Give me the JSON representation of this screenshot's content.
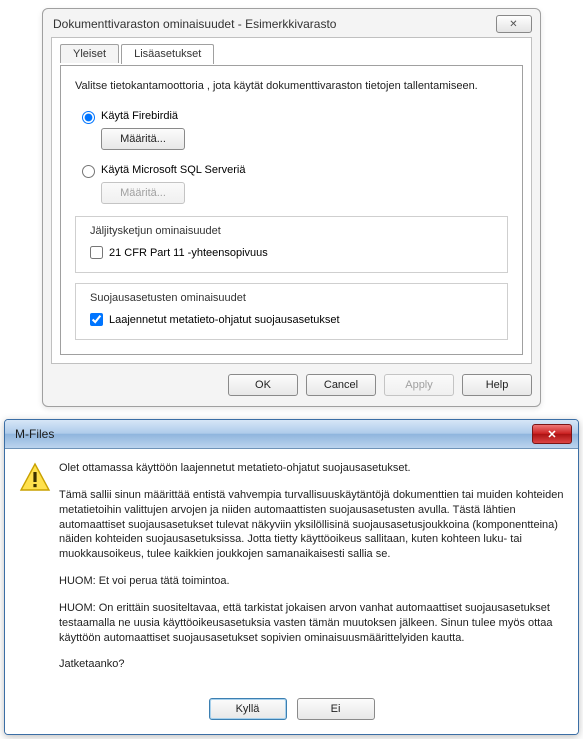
{
  "dialog": {
    "title": "Dokumenttivaraston ominaisuudet - Esimerkkivarasto",
    "close_glyph": "✕",
    "tabs": {
      "general": "Yleiset",
      "advanced": "Lisäasetukset"
    },
    "description": "Valitse tietokantamoottoria , jota käytät dokumenttivaraston tietojen tallentamiseen.",
    "radios": {
      "firebird": "Käytä Firebirdiä",
      "mssql": "Käytä Microsoft SQL Serveriä"
    },
    "define_btn": "Määritä...",
    "group_audit": {
      "legend": "Jäljitysketjun ominaisuudet",
      "cfr": "21 CFR Part 11 -yhteensopivuus"
    },
    "group_security": {
      "legend": "Suojausasetusten ominaisuudet",
      "extended": "Laajennetut metatieto-ohjatut suojausasetukset"
    },
    "buttons": {
      "ok": "OK",
      "cancel": "Cancel",
      "apply": "Apply",
      "help": "Help"
    }
  },
  "msgbox": {
    "title": "M-Files",
    "close_glyph": "✕",
    "p1": "Olet ottamassa käyttöön laajennetut metatieto-ohjatut suojausasetukset.",
    "p2": "Tämä sallii sinun määrittää entistä vahvempia turvallisuuskäytäntöjä dokumenttien tai muiden kohteiden metatietoihin valittujen arvojen ja niiden automaattisten suojausasetusten avulla. Tästä lähtien automaattiset suojausasetukset tulevat näkyviin yksilöllisinä suojausasetusjoukkoina (komponentteina) näiden kohteiden suojausasetuksissa. Jotta tietty käyttöoikeus sallitaan, kuten kohteen luku- tai muokkausoikeus, tulee kaikkien joukkojen samanaikaisesti sallia se.",
    "p3": "HUOM: Et voi perua tätä toimintoa.",
    "p4": "HUOM: On erittäin suositeltavaa, että tarkistat jokaisen arvon vanhat automaattiset suojausasetukset testaamalla ne uusia käyttöoikeusasetuksia vasten tämän muutoksen jälkeen. Sinun tulee myös ottaa käyttöön automaattiset suojausasetukset sopivien ominaisuusmäärittelyiden kautta.",
    "p5": "Jatketaanko?",
    "buttons": {
      "yes": "Kyllä",
      "no": "Ei"
    }
  }
}
